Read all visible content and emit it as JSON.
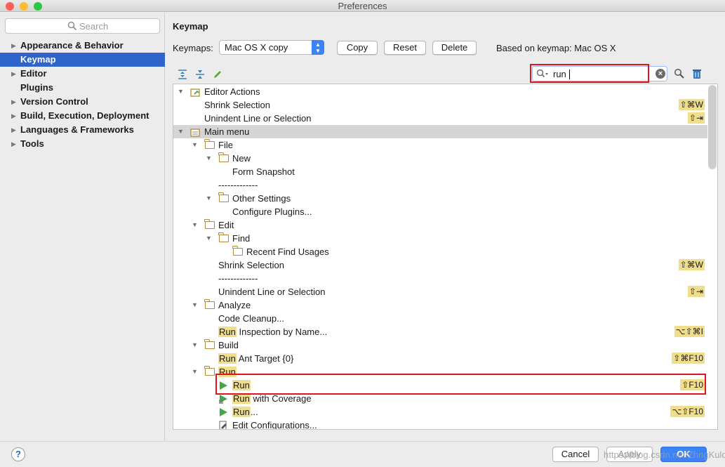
{
  "window": {
    "title": "Preferences",
    "colors": {
      "close": "#ff5f57",
      "min": "#febc2e",
      "max": "#28c840",
      "accent": "#3b83f7",
      "highlight_box": "#e0141e",
      "match": "#f0de8c"
    }
  },
  "sidebar": {
    "search_placeholder": "Search",
    "items": [
      {
        "label": "Appearance & Behavior",
        "expandable": true,
        "selected": false
      },
      {
        "label": "Keymap",
        "expandable": false,
        "selected": true
      },
      {
        "label": "Editor",
        "expandable": true,
        "selected": false
      },
      {
        "label": "Plugins",
        "expandable": false,
        "selected": false
      },
      {
        "label": "Version Control",
        "expandable": true,
        "selected": false
      },
      {
        "label": "Build, Execution, Deployment",
        "expandable": true,
        "selected": false
      },
      {
        "label": "Languages & Frameworks",
        "expandable": true,
        "selected": false
      },
      {
        "label": "Tools",
        "expandable": true,
        "selected": false
      }
    ]
  },
  "main": {
    "title": "Keymap",
    "keymaps_label": "Keymaps:",
    "keymap_value": "Mac OS X copy",
    "copy_label": "Copy",
    "reset_label": "Reset",
    "delete_label": "Delete",
    "based_on": "Based on keymap: Mac OS X",
    "filter_value": "run"
  },
  "tree": [
    {
      "indent": 0,
      "tri": "▼",
      "icon": "editor-actions",
      "label": "Editor Actions",
      "shortcut": "⇧⌘W",
      "shortcut_row": 1
    },
    {
      "indent": 1,
      "icon": "none",
      "label": "Shrink Selection",
      "shortcut": "⇧⌘W"
    },
    {
      "indent": 1,
      "icon": "none",
      "label": "Unindent Line or Selection",
      "shortcut": "⇧⇥"
    },
    {
      "indent": 0,
      "tri": "▼",
      "icon": "main-menu",
      "label": "Main menu",
      "highlight": true
    },
    {
      "indent": 1,
      "tri": "▼",
      "icon": "folder",
      "label": "File"
    },
    {
      "indent": 2,
      "tri": "▼",
      "icon": "folder",
      "label": "New"
    },
    {
      "indent": 3,
      "icon": "none",
      "label": "Form Snapshot"
    },
    {
      "indent": 2,
      "icon": "none",
      "label": "-------------"
    },
    {
      "indent": 2,
      "tri": "▼",
      "icon": "folder",
      "label": "Other Settings"
    },
    {
      "indent": 3,
      "icon": "none",
      "label": "Configure Plugins..."
    },
    {
      "indent": 1,
      "tri": "▼",
      "icon": "folder",
      "label": "Edit"
    },
    {
      "indent": 2,
      "tri": "▼",
      "icon": "folder",
      "label": "Find"
    },
    {
      "indent": 3,
      "icon": "folder",
      "label": "Recent Find Usages"
    },
    {
      "indent": 2,
      "icon": "none",
      "label": "Shrink Selection",
      "shortcut": "⇧⌘W"
    },
    {
      "indent": 2,
      "icon": "none",
      "label": "-------------"
    },
    {
      "indent": 2,
      "icon": "none",
      "label": "Unindent Line or Selection",
      "shortcut": "⇧⇥"
    },
    {
      "indent": 1,
      "tri": "▼",
      "icon": "folder",
      "label": "Analyze"
    },
    {
      "indent": 2,
      "icon": "none",
      "label": "Code Cleanup..."
    },
    {
      "indent": 2,
      "icon": "none",
      "match": "Run",
      "label": " Inspection by Name...",
      "shortcut": "⌥⇧⌘I"
    },
    {
      "indent": 1,
      "tri": "▼",
      "icon": "folder",
      "label": "Build"
    },
    {
      "indent": 2,
      "icon": "none",
      "match": "Run",
      "label": " Ant Target {0}",
      "shortcut": "⇧⌘F10"
    },
    {
      "indent": 1,
      "tri": "▼",
      "icon": "folder",
      "match": "Run",
      "label": ""
    },
    {
      "indent": 2,
      "icon": "run",
      "match": "Run",
      "label": "",
      "shortcut": "⇧F10"
    },
    {
      "indent": 2,
      "icon": "coverage",
      "match": "Run",
      "label": " with Coverage"
    },
    {
      "indent": 2,
      "icon": "run",
      "match": "Run",
      "label": "...",
      "shortcut": "⌥⇧F10"
    },
    {
      "indent": 2,
      "icon": "edit-config",
      "label": "Edit Configurations..."
    }
  ],
  "footer": {
    "help_label": "?",
    "cancel_label": "Cancel",
    "apply_label": "Apply",
    "ok_label": "OK",
    "watermark": "https://blog.csdn.net/ZhngKulong"
  }
}
